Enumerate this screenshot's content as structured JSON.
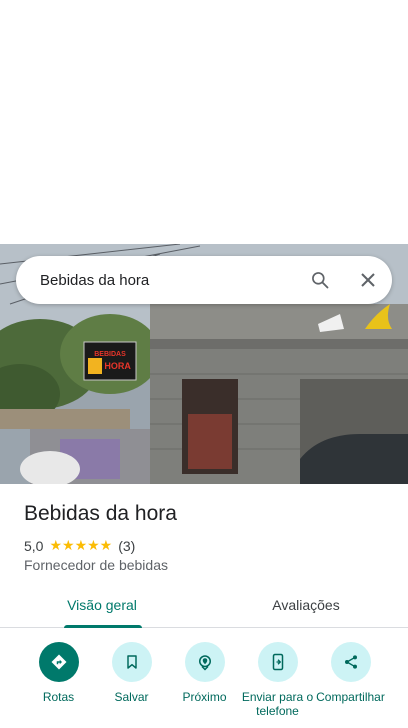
{
  "search": {
    "query": "Bebidas da hora"
  },
  "photo": {
    "sign_text_line1": "BEBIDAS",
    "sign_text_line2": "DA HORA"
  },
  "place": {
    "name": "Bebidas da hora",
    "rating": "5,0",
    "stars": "★★★★★",
    "review_count": "(3)",
    "category": "Fornecedor de bebidas"
  },
  "tabs": [
    {
      "label": "Visão geral"
    },
    {
      "label": "Avaliações"
    }
  ],
  "actions": [
    {
      "label": "Rotas",
      "icon": "directions-icon"
    },
    {
      "label": "Salvar",
      "icon": "bookmark-icon"
    },
    {
      "label": "Próximo",
      "icon": "nearby-icon"
    },
    {
      "label": "Enviar para o telefone",
      "icon": "send-to-phone-icon"
    },
    {
      "label": "Compartilhar",
      "icon": "share-icon"
    }
  ],
  "colors": {
    "accent": "#00796b",
    "action_bg": "#cdf3f5",
    "star": "#fbbc04"
  }
}
